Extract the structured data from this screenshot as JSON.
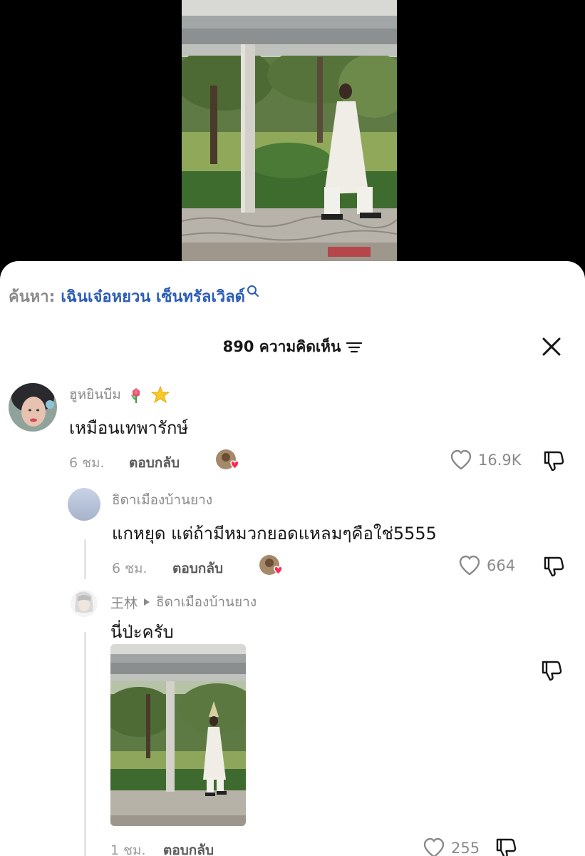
{
  "search": {
    "prefix": "ค้นหา:",
    "term": "เฉินเจ๋อหยวน เซ็นทรัลเวิลด์"
  },
  "header": {
    "title": "890 ความคิดเห็น"
  },
  "comments": [
    {
      "username": "ฮูหยินบีม",
      "text": "เหมือนเทพารักษ์",
      "time": "6 ชม.",
      "reply_label": "ตอบกลับ",
      "likes": "16.9K"
    },
    {
      "username": "ธิดาเมืองบ้านยาง",
      "text": "แกหยุด แต่ถ้ามีหมวกยอดแหลมๆคือใช่5555",
      "time": "6 ชม.",
      "reply_label": "ตอบกลับ",
      "likes": "664"
    },
    {
      "username": "王林",
      "reply_to": "ธิดาเมืองบ้านยาง",
      "text": "นี่ป่ะครับ",
      "time": "1 ชม.",
      "reply_label": "ตอบกลับ",
      "likes": "255"
    }
  ],
  "colors": {
    "accent_blue": "#2b5db6",
    "heart_red": "#fe2c55",
    "muted_gray": "#8a8a8a"
  }
}
